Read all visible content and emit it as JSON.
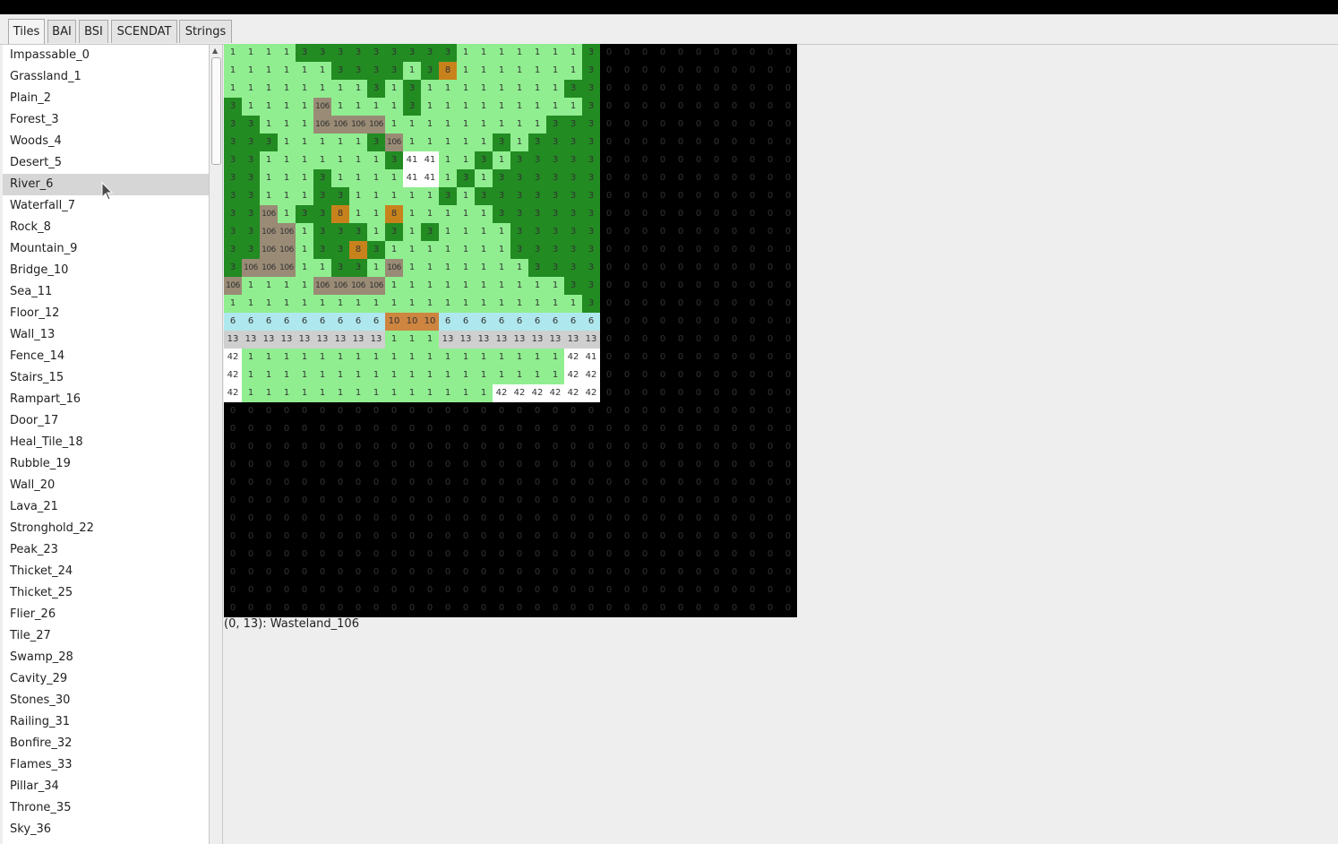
{
  "tabs": [
    {
      "label": "Tiles",
      "active": true
    },
    {
      "label": "BAI",
      "active": false
    },
    {
      "label": "BSI",
      "active": false
    },
    {
      "label": "SCENDAT",
      "active": false
    },
    {
      "label": "Strings",
      "active": false
    }
  ],
  "tile_list": {
    "selected_index": 6,
    "items": [
      "Impassable_0",
      "Grassland_1",
      "Plain_2",
      "Forest_3",
      "Woods_4",
      "Desert_5",
      "River_6",
      "Waterfall_7",
      "Rock_8",
      "Mountain_9",
      "Bridge_10",
      "Sea_11",
      "Floor_12",
      "Wall_13",
      "Fence_14",
      "Stairs_15",
      "Rampart_16",
      "Door_17",
      "Heal_Tile_18",
      "Rubble_19",
      "Wall_20",
      "Lava_21",
      "Stronghold_22",
      "Peak_23",
      "Thicket_24",
      "Thicket_25",
      "Flier_26",
      "Tile_27",
      "Swamp_28",
      "Cavity_29",
      "Stones_30",
      "Railing_31",
      "Bonfire_32",
      "Flames_33",
      "Pillar_34",
      "Throne_35",
      "Sky_36"
    ]
  },
  "map": {
    "rows": [
      [
        1,
        1,
        1,
        1,
        3,
        3,
        3,
        3,
        3,
        3,
        3,
        3,
        3,
        1,
        1,
        1,
        1,
        1,
        1,
        1,
        3,
        0,
        0,
        0,
        0,
        0,
        0,
        0,
        0,
        0,
        0,
        0
      ],
      [
        1,
        1,
        1,
        1,
        1,
        1,
        3,
        3,
        3,
        3,
        1,
        3,
        8,
        1,
        1,
        1,
        1,
        1,
        1,
        1,
        3,
        0,
        0,
        0,
        0,
        0,
        0,
        0,
        0,
        0,
        0,
        0
      ],
      [
        1,
        1,
        1,
        1,
        1,
        1,
        1,
        1,
        3,
        1,
        3,
        1,
        1,
        1,
        1,
        1,
        1,
        1,
        1,
        3,
        3,
        0,
        0,
        0,
        0,
        0,
        0,
        0,
        0,
        0,
        0,
        0
      ],
      [
        3,
        1,
        1,
        1,
        1,
        106,
        1,
        1,
        1,
        1,
        3,
        1,
        1,
        1,
        1,
        1,
        1,
        1,
        1,
        1,
        3,
        0,
        0,
        0,
        0,
        0,
        0,
        0,
        0,
        0,
        0,
        0
      ],
      [
        3,
        3,
        1,
        1,
        1,
        106,
        106,
        106,
        106,
        1,
        1,
        1,
        1,
        1,
        1,
        1,
        1,
        1,
        3,
        3,
        3,
        0,
        0,
        0,
        0,
        0,
        0,
        0,
        0,
        0,
        0,
        0
      ],
      [
        3,
        3,
        3,
        1,
        1,
        1,
        1,
        1,
        3,
        106,
        1,
        1,
        1,
        1,
        1,
        3,
        1,
        3,
        3,
        3,
        3,
        0,
        0,
        0,
        0,
        0,
        0,
        0,
        0,
        0,
        0,
        0
      ],
      [
        3,
        3,
        1,
        1,
        1,
        1,
        1,
        1,
        1,
        3,
        41,
        41,
        1,
        1,
        3,
        1,
        3,
        3,
        3,
        3,
        3,
        0,
        0,
        0,
        0,
        0,
        0,
        0,
        0,
        0,
        0,
        0
      ],
      [
        3,
        3,
        1,
        1,
        1,
        3,
        1,
        1,
        1,
        1,
        41,
        41,
        1,
        3,
        1,
        3,
        3,
        3,
        3,
        3,
        3,
        0,
        0,
        0,
        0,
        0,
        0,
        0,
        0,
        0,
        0,
        0
      ],
      [
        3,
        3,
        1,
        1,
        1,
        3,
        3,
        1,
        1,
        1,
        1,
        1,
        3,
        1,
        3,
        3,
        3,
        3,
        3,
        3,
        3,
        0,
        0,
        0,
        0,
        0,
        0,
        0,
        0,
        0,
        0,
        0
      ],
      [
        3,
        3,
        106,
        1,
        3,
        3,
        8,
        1,
        1,
        8,
        1,
        1,
        1,
        1,
        1,
        3,
        3,
        3,
        3,
        3,
        3,
        0,
        0,
        0,
        0,
        0,
        0,
        0,
        0,
        0,
        0,
        0
      ],
      [
        3,
        3,
        106,
        106,
        1,
        3,
        3,
        3,
        1,
        3,
        1,
        3,
        1,
        1,
        1,
        1,
        3,
        3,
        3,
        3,
        3,
        0,
        0,
        0,
        0,
        0,
        0,
        0,
        0,
        0,
        0,
        0
      ],
      [
        3,
        3,
        106,
        106,
        1,
        3,
        3,
        8,
        3,
        1,
        1,
        1,
        1,
        1,
        1,
        1,
        3,
        3,
        3,
        3,
        3,
        0,
        0,
        0,
        0,
        0,
        0,
        0,
        0,
        0,
        0,
        0
      ],
      [
        3,
        106,
        106,
        106,
        1,
        1,
        3,
        3,
        1,
        106,
        1,
        1,
        1,
        1,
        1,
        1,
        1,
        3,
        3,
        3,
        3,
        0,
        0,
        0,
        0,
        0,
        0,
        0,
        0,
        0,
        0,
        0
      ],
      [
        106,
        1,
        1,
        1,
        1,
        106,
        106,
        106,
        106,
        1,
        1,
        1,
        1,
        1,
        1,
        1,
        1,
        1,
        1,
        3,
        3,
        0,
        0,
        0,
        0,
        0,
        0,
        0,
        0,
        0,
        0,
        0
      ],
      [
        1,
        1,
        1,
        1,
        1,
        1,
        1,
        1,
        1,
        1,
        1,
        1,
        1,
        1,
        1,
        1,
        1,
        1,
        1,
        1,
        3,
        0,
        0,
        0,
        0,
        0,
        0,
        0,
        0,
        0,
        0,
        0
      ],
      [
        6,
        6,
        6,
        6,
        6,
        6,
        6,
        6,
        6,
        10,
        10,
        10,
        6,
        6,
        6,
        6,
        6,
        6,
        6,
        6,
        6,
        0,
        0,
        0,
        0,
        0,
        0,
        0,
        0,
        0,
        0,
        0
      ],
      [
        13,
        13,
        13,
        13,
        13,
        13,
        13,
        13,
        13,
        1,
        1,
        1,
        13,
        13,
        13,
        13,
        13,
        13,
        13,
        13,
        13,
        0,
        0,
        0,
        0,
        0,
        0,
        0,
        0,
        0,
        0,
        0
      ],
      [
        42,
        1,
        1,
        1,
        1,
        1,
        1,
        1,
        1,
        1,
        1,
        1,
        1,
        1,
        1,
        1,
        1,
        1,
        1,
        42,
        41,
        0,
        0,
        0,
        0,
        0,
        0,
        0,
        0,
        0,
        0,
        0
      ],
      [
        42,
        1,
        1,
        1,
        1,
        1,
        1,
        1,
        1,
        1,
        1,
        1,
        1,
        1,
        1,
        1,
        1,
        1,
        1,
        42,
        42,
        0,
        0,
        0,
        0,
        0,
        0,
        0,
        0,
        0,
        0,
        0
      ],
      [
        42,
        1,
        1,
        1,
        1,
        1,
        1,
        1,
        1,
        1,
        1,
        1,
        1,
        1,
        1,
        42,
        42,
        42,
        42,
        42,
        42,
        0,
        0,
        0,
        0,
        0,
        0,
        0,
        0,
        0,
        0,
        0
      ],
      [
        0,
        0,
        0,
        0,
        0,
        0,
        0,
        0,
        0,
        0,
        0,
        0,
        0,
        0,
        0,
        0,
        0,
        0,
        0,
        0,
        0,
        0,
        0,
        0,
        0,
        0,
        0,
        0,
        0,
        0,
        0,
        0
      ],
      [
        0,
        0,
        0,
        0,
        0,
        0,
        0,
        0,
        0,
        0,
        0,
        0,
        0,
        0,
        0,
        0,
        0,
        0,
        0,
        0,
        0,
        0,
        0,
        0,
        0,
        0,
        0,
        0,
        0,
        0,
        0,
        0
      ],
      [
        0,
        0,
        0,
        0,
        0,
        0,
        0,
        0,
        0,
        0,
        0,
        0,
        0,
        0,
        0,
        0,
        0,
        0,
        0,
        0,
        0,
        0,
        0,
        0,
        0,
        0,
        0,
        0,
        0,
        0,
        0,
        0
      ],
      [
        0,
        0,
        0,
        0,
        0,
        0,
        0,
        0,
        0,
        0,
        0,
        0,
        0,
        0,
        0,
        0,
        0,
        0,
        0,
        0,
        0,
        0,
        0,
        0,
        0,
        0,
        0,
        0,
        0,
        0,
        0,
        0
      ],
      [
        0,
        0,
        0,
        0,
        0,
        0,
        0,
        0,
        0,
        0,
        0,
        0,
        0,
        0,
        0,
        0,
        0,
        0,
        0,
        0,
        0,
        0,
        0,
        0,
        0,
        0,
        0,
        0,
        0,
        0,
        0,
        0
      ],
      [
        0,
        0,
        0,
        0,
        0,
        0,
        0,
        0,
        0,
        0,
        0,
        0,
        0,
        0,
        0,
        0,
        0,
        0,
        0,
        0,
        0,
        0,
        0,
        0,
        0,
        0,
        0,
        0,
        0,
        0,
        0,
        0
      ],
      [
        0,
        0,
        0,
        0,
        0,
        0,
        0,
        0,
        0,
        0,
        0,
        0,
        0,
        0,
        0,
        0,
        0,
        0,
        0,
        0,
        0,
        0,
        0,
        0,
        0,
        0,
        0,
        0,
        0,
        0,
        0,
        0
      ],
      [
        0,
        0,
        0,
        0,
        0,
        0,
        0,
        0,
        0,
        0,
        0,
        0,
        0,
        0,
        0,
        0,
        0,
        0,
        0,
        0,
        0,
        0,
        0,
        0,
        0,
        0,
        0,
        0,
        0,
        0,
        0,
        0
      ],
      [
        0,
        0,
        0,
        0,
        0,
        0,
        0,
        0,
        0,
        0,
        0,
        0,
        0,
        0,
        0,
        0,
        0,
        0,
        0,
        0,
        0,
        0,
        0,
        0,
        0,
        0,
        0,
        0,
        0,
        0,
        0,
        0
      ],
      [
        0,
        0,
        0,
        0,
        0,
        0,
        0,
        0,
        0,
        0,
        0,
        0,
        0,
        0,
        0,
        0,
        0,
        0,
        0,
        0,
        0,
        0,
        0,
        0,
        0,
        0,
        0,
        0,
        0,
        0,
        0,
        0
      ],
      [
        0,
        0,
        0,
        0,
        0,
        0,
        0,
        0,
        0,
        0,
        0,
        0,
        0,
        0,
        0,
        0,
        0,
        0,
        0,
        0,
        0,
        0,
        0,
        0,
        0,
        0,
        0,
        0,
        0,
        0,
        0,
        0
      ],
      [
        0,
        0,
        0,
        0,
        0,
        0,
        0,
        0,
        0,
        0,
        0,
        0,
        0,
        0,
        0,
        0,
        0,
        0,
        0,
        0,
        0,
        0,
        0,
        0,
        0,
        0,
        0,
        0,
        0,
        0,
        0,
        0
      ]
    ]
  },
  "tile_colors": {
    "0": "#000000",
    "1": "#90ee90",
    "3": "#228b22",
    "6": "#aee8ee",
    "8": "#c8821c",
    "10": "#cd8540",
    "13": "#cfcfcf",
    "41": "#ffffff",
    "42": "#ffffff",
    "106": "#998b75"
  },
  "zero_text_color": "#333333",
  "status_text": "(0, 13): Wasteland_106"
}
